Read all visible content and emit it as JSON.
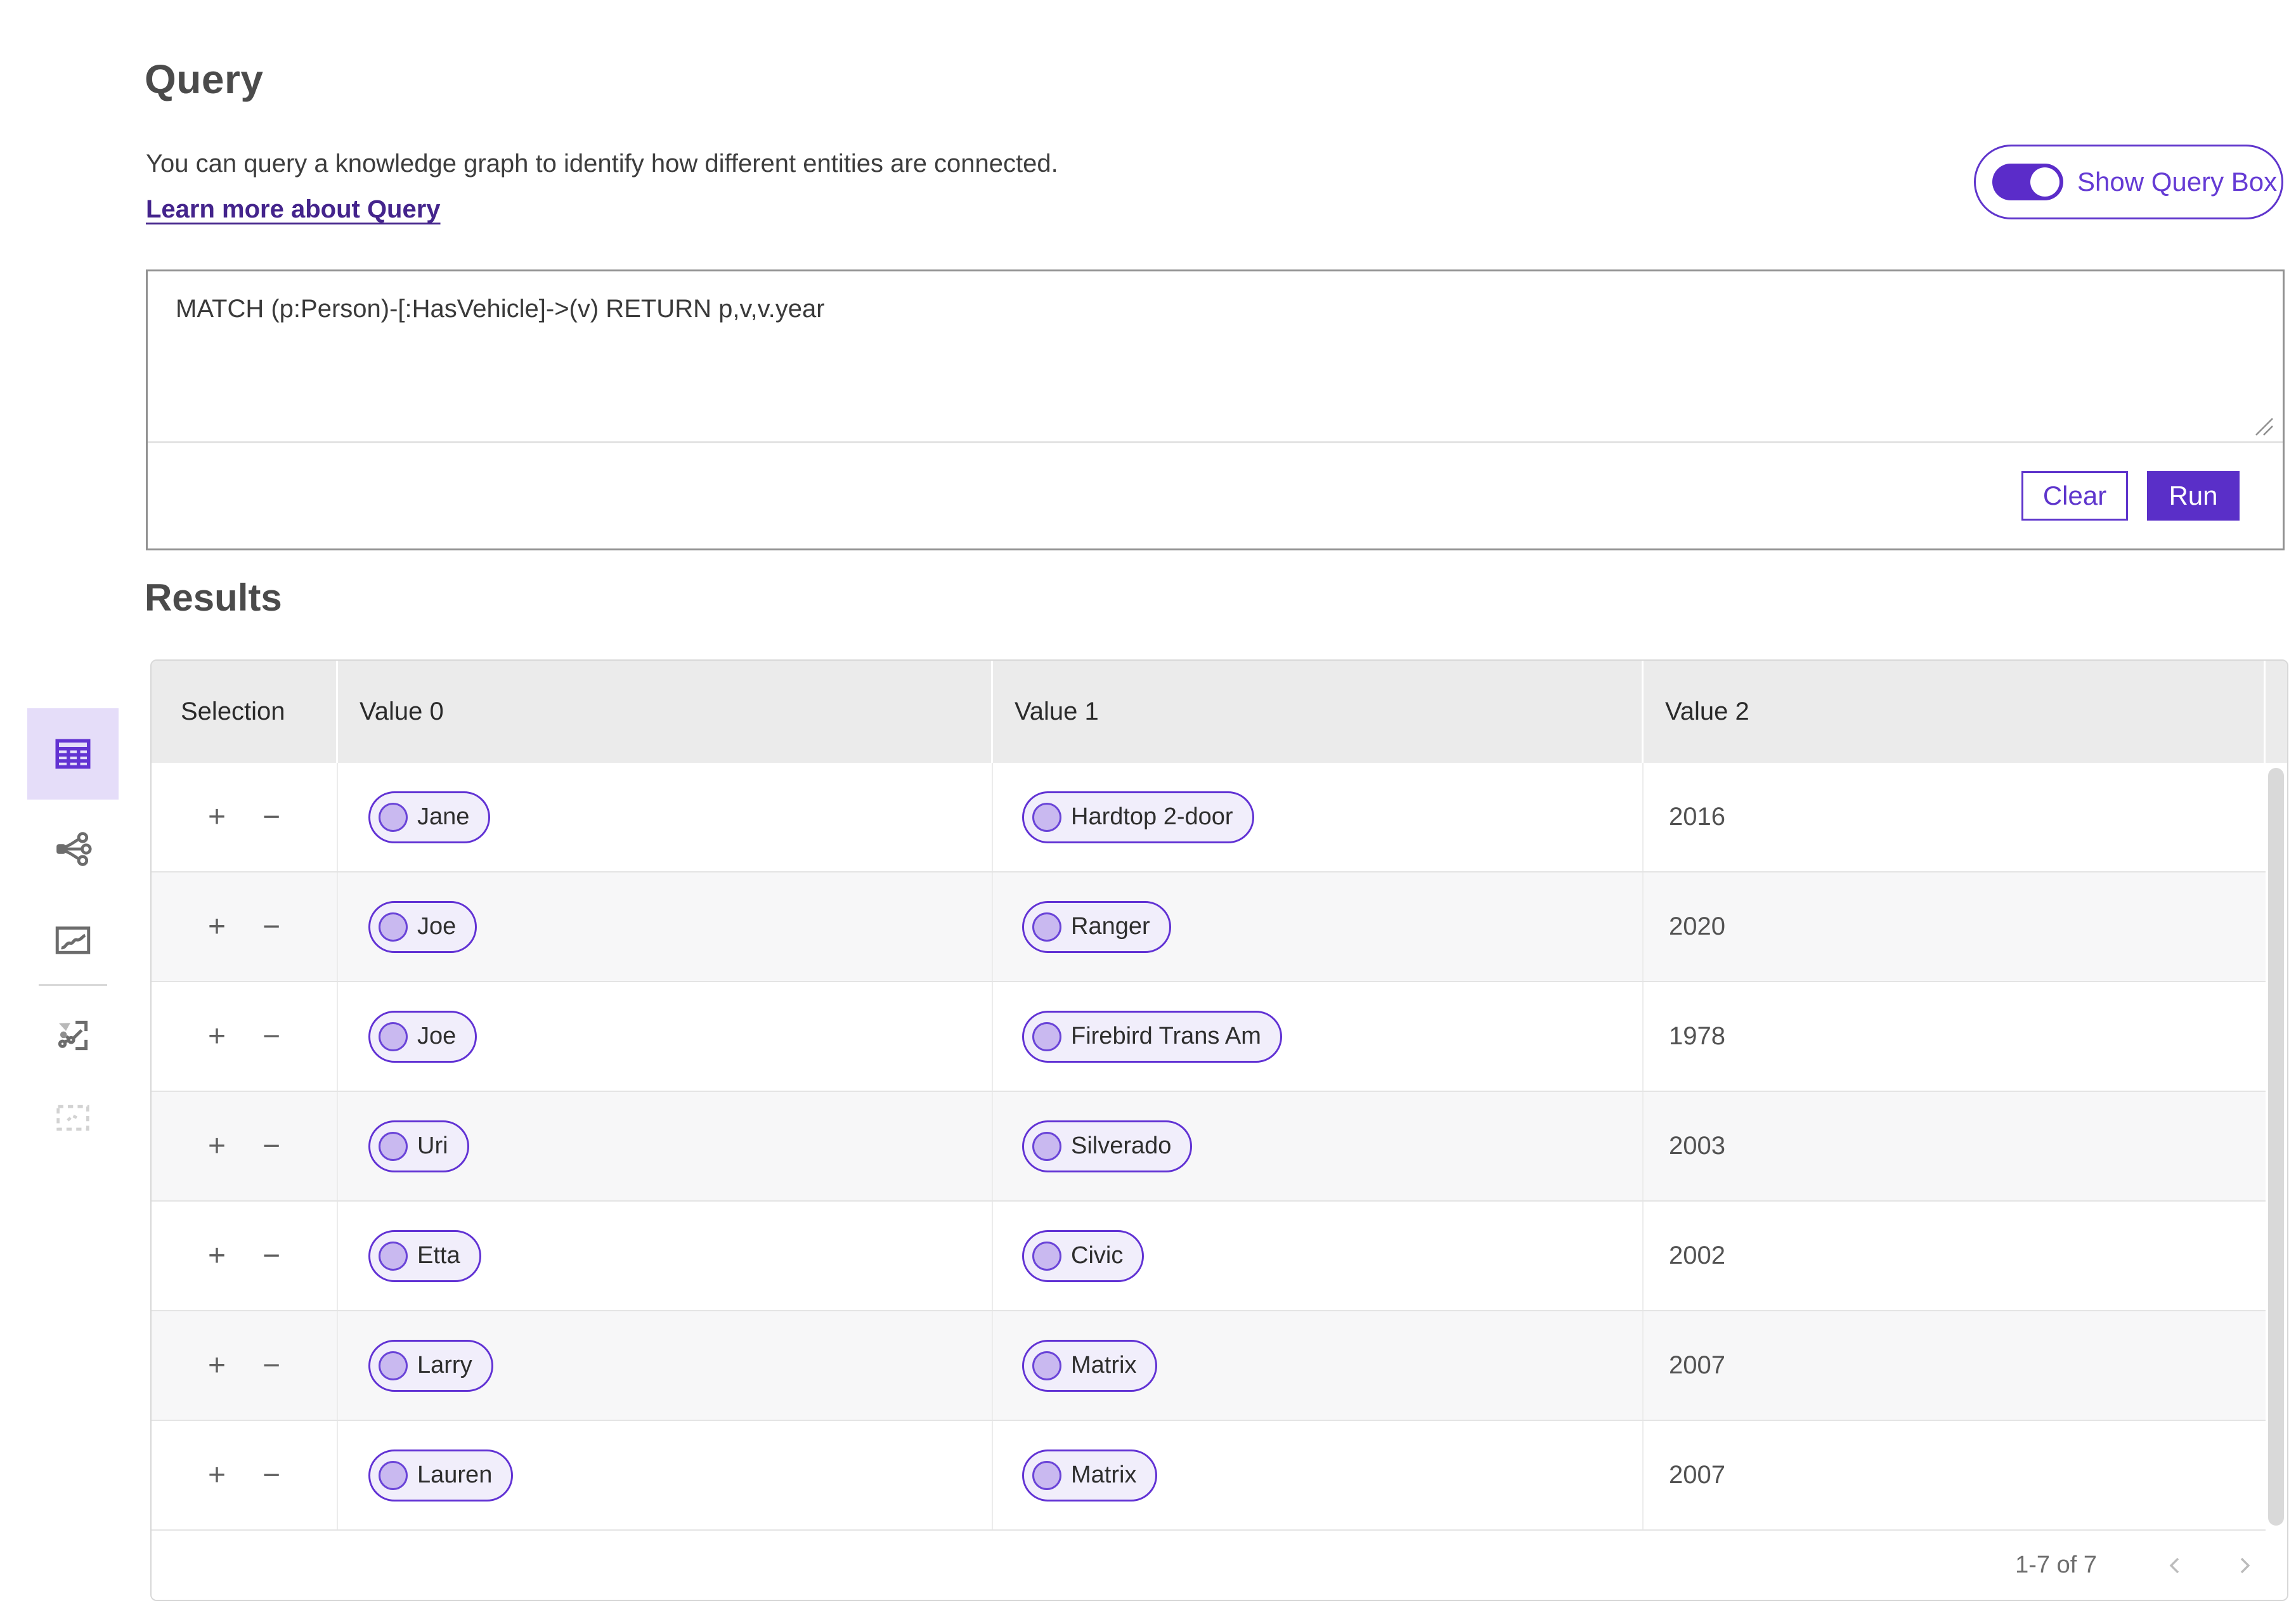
{
  "header": {
    "title": "Query",
    "description": "You can query a knowledge graph to identify how different entities are connected.",
    "learn_more": "Learn more about Query",
    "toggle_label": "Show Query Box",
    "toggle_state": "on"
  },
  "query_box": {
    "value": "MATCH (p:Person)-[:HasVehicle]->(v) RETURN p,v,v.year",
    "clear_label": "Clear",
    "run_label": "Run"
  },
  "results": {
    "title": "Results",
    "columns": [
      "Selection",
      "Value 0",
      "Value 1",
      "Value 2"
    ],
    "selection_plus": "+",
    "selection_minus": "−",
    "rows": [
      {
        "value0": "Jane",
        "value1": "Hardtop 2-door",
        "value2": "2016"
      },
      {
        "value0": "Joe",
        "value1": "Ranger",
        "value2": "2020"
      },
      {
        "value0": "Joe",
        "value1": "Firebird Trans Am",
        "value2": "1978"
      },
      {
        "value0": "Uri",
        "value1": "Silverado",
        "value2": "2003"
      },
      {
        "value0": "Etta",
        "value1": "Civic",
        "value2": "2002"
      },
      {
        "value0": "Larry",
        "value1": "Matrix",
        "value2": "2007"
      },
      {
        "value0": "Lauren",
        "value1": "Matrix",
        "value2": "2007"
      }
    ],
    "pagination": {
      "range_label": "1-7 of 7",
      "prev_icon": "chevron-left",
      "next_icon": "chevron-right"
    }
  },
  "sidebar": {
    "items": [
      {
        "icon": "table-view-icon",
        "active": true,
        "disabled": false
      },
      {
        "icon": "graph-view-icon",
        "active": false,
        "disabled": false
      },
      {
        "icon": "chart-view-icon",
        "active": false,
        "disabled": false
      },
      {
        "icon": "graph-frame-view-icon",
        "active": false,
        "disabled": false
      },
      {
        "icon": "selection-view-icon",
        "active": false,
        "disabled": true
      }
    ]
  },
  "colors": {
    "accent": "#5a2fc8",
    "accent_border": "#5f35cc",
    "accent_light_bg": "#e5ddf9",
    "pill_bg": "#f1eefb",
    "pill_circle": "#c9b9f0",
    "link": "#44248c",
    "header_bg": "#ebebeb",
    "alt_row_bg": "#f7f7f8"
  }
}
